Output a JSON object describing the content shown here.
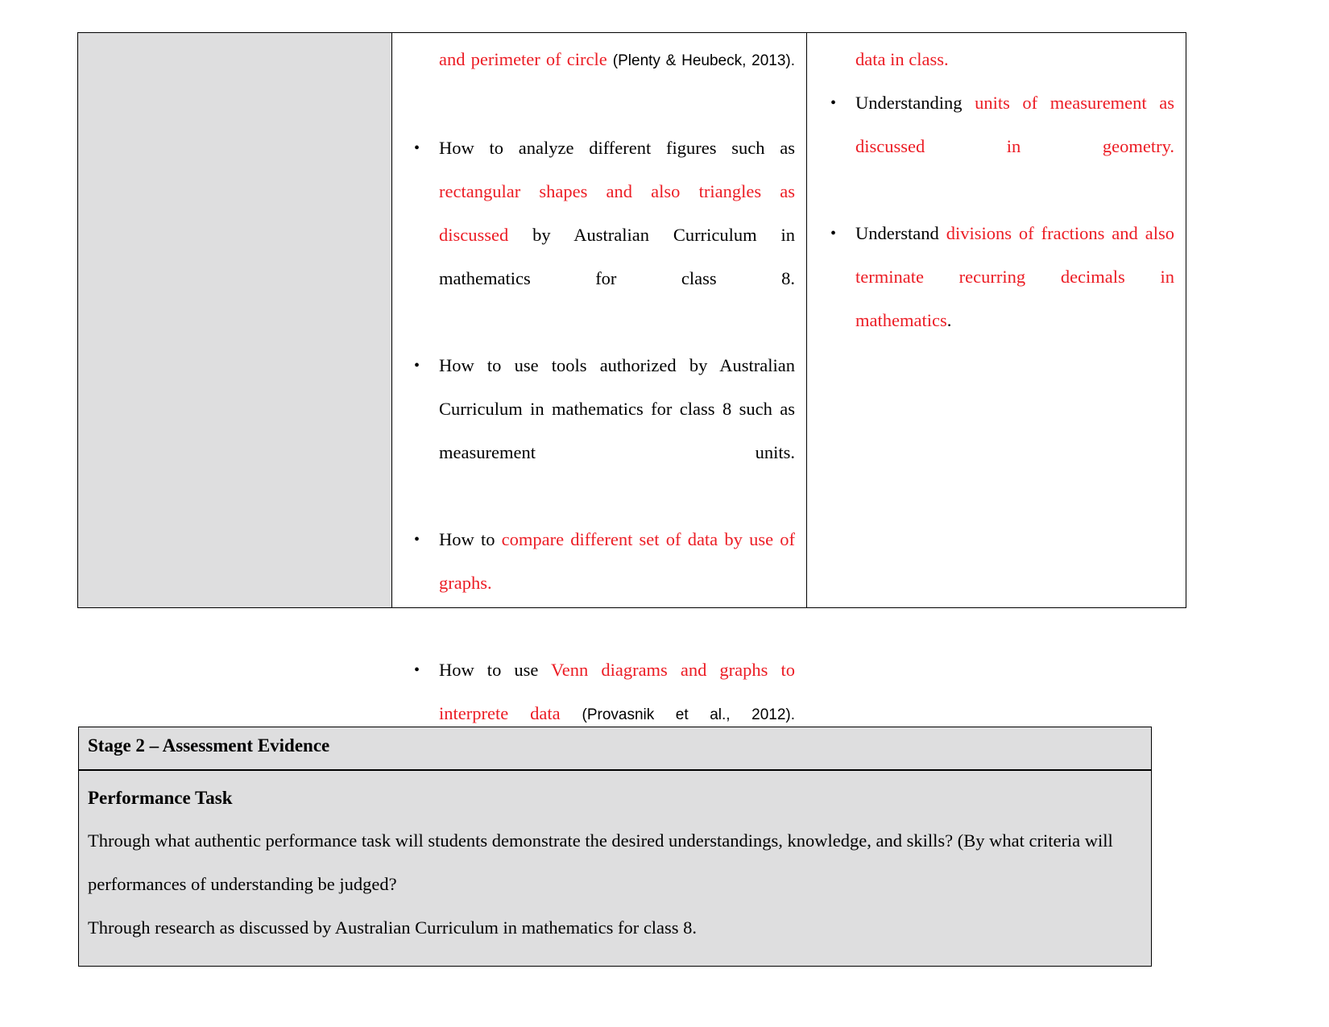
{
  "document": {
    "type": "curriculum-unit-plan-table"
  },
  "top_table": {
    "columns": [
      {
        "name": "left-empty-shaded-cell",
        "content": ""
      },
      {
        "name": "knowledge-column"
      },
      {
        "name": "skills-column"
      }
    ],
    "knowledge_column": {
      "continued_paragraph": {
        "red_text": "and perimeter of circle",
        "citation": "(Plenty & Heubeck, 2013)."
      },
      "bullets": [
        {
          "segments": [
            {
              "text": "How to analyze different figures such as ",
              "color": "black"
            },
            {
              "text": "rectangular shapes and also triangles as discussed ",
              "color": "red"
            },
            {
              "text": "by Australian Curriculum in mathematics for class 8.",
              "color": "black"
            }
          ]
        },
        {
          "segments": [
            {
              "text": "How to use tools authorized by Australian Curriculum in mathematics for class 8 such as measurement units.",
              "color": "black"
            }
          ]
        },
        {
          "segments": [
            {
              "text": "How to ",
              "color": "black"
            },
            {
              "text": "compare different set of data by use of graphs.",
              "color": "red"
            }
          ]
        },
        {
          "segments": [
            {
              "text": "How to use ",
              "color": "black"
            },
            {
              "text": "Venn diagrams and graphs to interprete data ",
              "color": "red"
            },
            {
              "text": "(Provasnik et al., 2012).",
              "color": "citation"
            }
          ]
        }
      ]
    },
    "skills_column": {
      "continued_paragraph": {
        "red_text": "data in class."
      },
      "bullets": [
        {
          "segments": [
            {
              "text": "Understanding ",
              "color": "black"
            },
            {
              "text": "units of measurement as discussed in geometry.",
              "color": "red"
            }
          ]
        },
        {
          "segments": [
            {
              "text": "Understand ",
              "color": "black"
            },
            {
              "text": "divisions of fractions and also terminate recurring decimals in mathematics",
              "color": "red"
            },
            {
              "text": ".",
              "color": "black"
            }
          ]
        }
      ]
    }
  },
  "bottom_table": {
    "stage_heading": "Stage 2 – Assessment Evidence",
    "performance_task": {
      "heading": "Performance Task",
      "paragraph_1": "Through what authentic performance task will students demonstrate the desired understandings, knowledge, and skills? (By what criteria will performances of understanding be judged?",
      "paragraph_2": "Through research as discussed by Australian Curriculum in mathematics for class 8."
    }
  },
  "colors": {
    "highlight_red": "#ec1c24",
    "cell_shade": "#dededf",
    "border": "#000000",
    "text": "#000000"
  }
}
